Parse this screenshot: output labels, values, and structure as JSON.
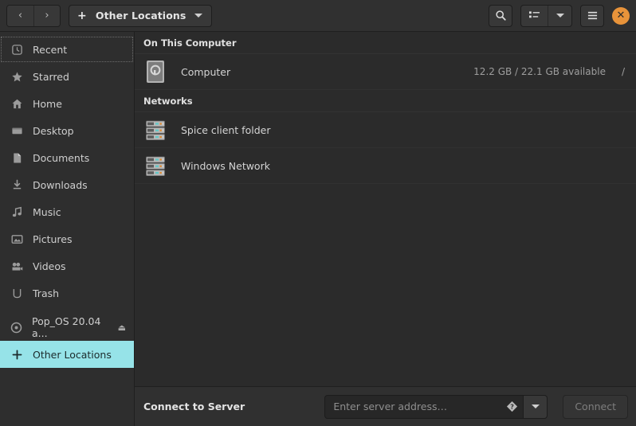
{
  "header": {
    "back_label": "‹",
    "forward_label": "›",
    "path_label": "Other Locations",
    "plus_label": "+",
    "close_label": "✕"
  },
  "sidebar": {
    "items": [
      {
        "label": "Recent",
        "icon": "clock-icon",
        "state": "focused"
      },
      {
        "label": "Starred",
        "icon": "star-icon",
        "state": "normal"
      },
      {
        "label": "Home",
        "icon": "home-icon",
        "state": "normal"
      },
      {
        "label": "Desktop",
        "icon": "desktop-icon",
        "state": "normal"
      },
      {
        "label": "Documents",
        "icon": "document-icon",
        "state": "normal"
      },
      {
        "label": "Downloads",
        "icon": "download-icon",
        "state": "normal"
      },
      {
        "label": "Music",
        "icon": "music-icon",
        "state": "normal"
      },
      {
        "label": "Pictures",
        "icon": "picture-icon",
        "state": "normal"
      },
      {
        "label": "Videos",
        "icon": "video-icon",
        "state": "normal"
      },
      {
        "label": "Trash",
        "icon": "trash-icon",
        "state": "normal"
      },
      {
        "label": "Pop_OS 20.04 a...",
        "icon": "disc-icon",
        "state": "normal",
        "eject": "⏏"
      },
      {
        "label": "Other Locations",
        "icon": "plus-icon",
        "state": "selected"
      }
    ]
  },
  "main": {
    "groups": [
      {
        "title": "On This Computer",
        "rows": [
          {
            "label": "Computer",
            "icon": "drive-icon",
            "meta": "12.2 GB / 22.1 GB available",
            "mount": "/"
          }
        ]
      },
      {
        "title": "Networks",
        "rows": [
          {
            "label": "Spice client folder",
            "icon": "network-server-icon",
            "meta": "",
            "mount": ""
          },
          {
            "label": "Windows Network",
            "icon": "network-server-icon",
            "meta": "",
            "mount": ""
          }
        ]
      }
    ]
  },
  "connect_bar": {
    "label": "Connect to Server",
    "address_value": "",
    "address_placeholder": "Enter server address…",
    "connect_label": "Connect"
  },
  "colors": {
    "accent_selection": "#96e3e8",
    "close_button": "#e8933a",
    "window_bg": "#2b2b2b",
    "sidebar_bg": "#2e2e2e",
    "header_bg": "#303030"
  }
}
